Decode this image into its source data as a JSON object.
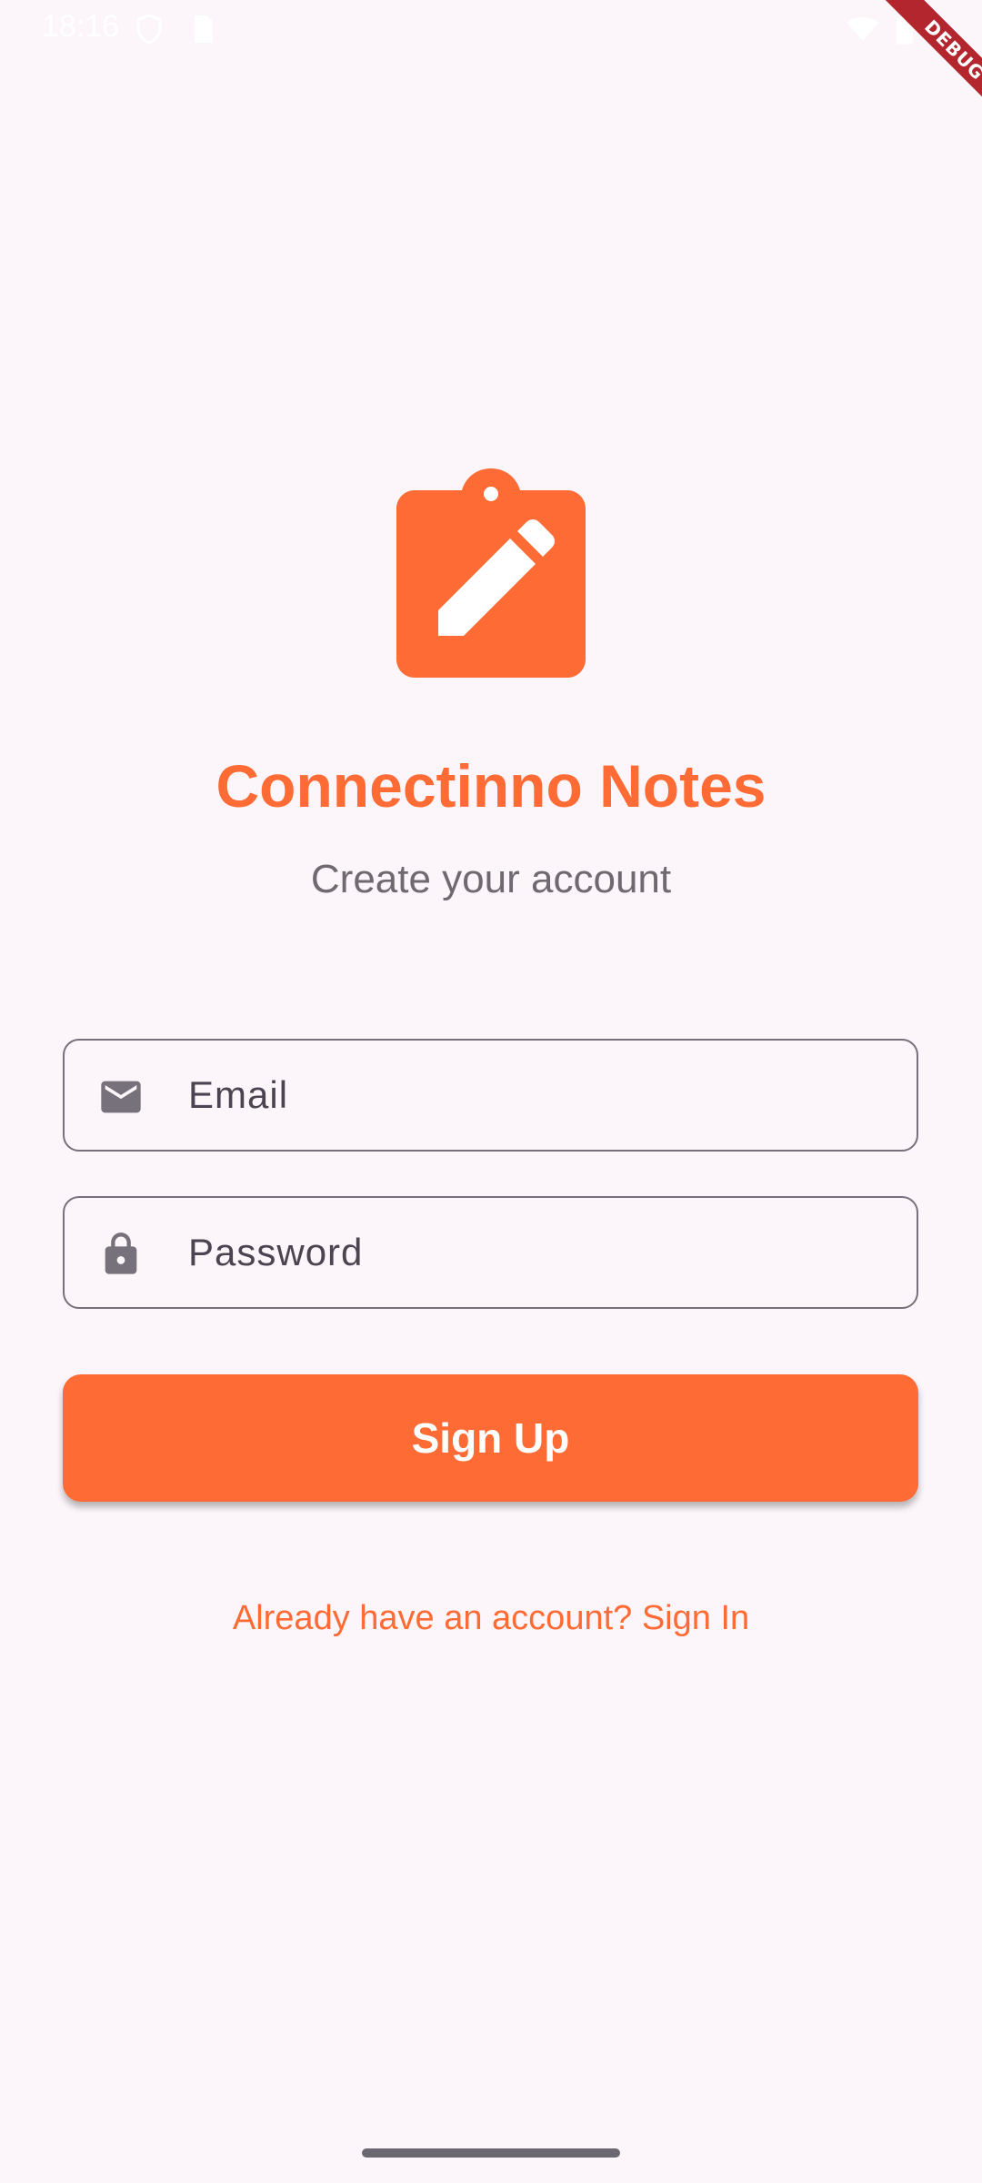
{
  "status_bar": {
    "time": "18:16",
    "icons": [
      "shield-icon",
      "sim-icon",
      "wifi-icon",
      "battery-icon"
    ]
  },
  "debug_banner": {
    "label": "DEBUG"
  },
  "branding": {
    "logo_icon": "clipboard-edit-icon",
    "title": "Connectinno Notes",
    "subtitle": "Create your account"
  },
  "form": {
    "email": {
      "icon": "mail-icon",
      "placeholder": "Email",
      "value": ""
    },
    "password": {
      "icon": "lock-icon",
      "placeholder": "Password",
      "value": ""
    },
    "submit_label": "Sign Up"
  },
  "footer": {
    "signin_link": "Already have an account? Sign In"
  },
  "colors": {
    "accent": "#FF6B35",
    "background": "#FCF6FB",
    "subtitle_text": "#6E6A70",
    "field_border": "#76717A",
    "debug_ribbon": "#B3262D"
  }
}
